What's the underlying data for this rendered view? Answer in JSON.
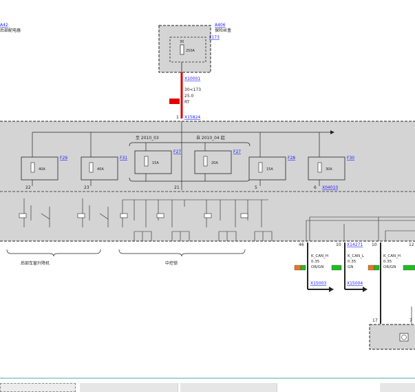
{
  "modules": {
    "a42": {
      "id": "A42",
      "label": "后部配电器"
    },
    "a406": {
      "id": "A406",
      "label": "保险丝盒"
    }
  },
  "top_fuse": {
    "ref": "F173",
    "num": "30",
    "rating": "250A"
  },
  "connectors": {
    "c1": "X10001",
    "c2": "X15824",
    "c3": "X04010",
    "c4": "X14271",
    "c5": "X15003",
    "c6": "X15004"
  },
  "wire_main": {
    "line1": "30<173",
    "line2": "25.0",
    "line3": "RT"
  },
  "pin_labels": {
    "p1": "1"
  },
  "date_ranges": {
    "before": "至 2010_03",
    "after": "自 2010_04 起"
  },
  "fuses": [
    {
      "ref": "F29",
      "rating": "40A",
      "pin": "22"
    },
    {
      "ref": "F31",
      "rating": "40A",
      "pin": "23"
    },
    {
      "ref": "F27",
      "rating": "15A",
      "pin": ""
    },
    {
      "ref": "F27",
      "rating": "20A",
      "pin": "21"
    },
    {
      "ref": "F28",
      "rating": "15A",
      "pin": "5"
    },
    {
      "ref": "F30",
      "rating": "30A",
      "pin": "6"
    }
  ],
  "groups": {
    "g1": "后部车窗升降机",
    "g2": "中控锁"
  },
  "can_wires": [
    {
      "pin_top": "46",
      "pin_top2": "10",
      "name": "K_CAN_H",
      "size": "0.35",
      "color": "OR/GN"
    },
    {
      "pin_top": "",
      "pin_top2": "",
      "name": "K_CAN_L",
      "size": "0.35",
      "color": "GN"
    },
    {
      "pin_top": "10",
      "pin_top2": "12",
      "name": "K_CAN_H",
      "size": "0.35",
      "color": "OR/GN"
    }
  ],
  "bottom_pins": {
    "a": "17",
    "b": "7"
  },
  "colors": {
    "link": "#1a1aff",
    "wire_red": "#e00000",
    "panel_gray": "#d4d4d4",
    "orange": "#e87722",
    "green": "#22bb22"
  }
}
